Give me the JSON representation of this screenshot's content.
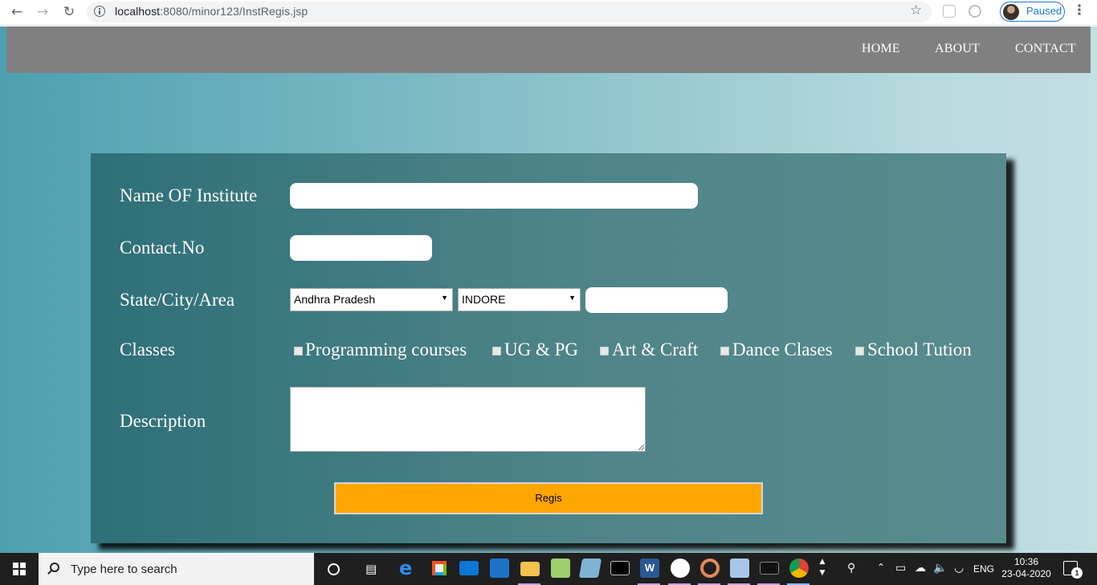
{
  "browser": {
    "url_host": "localhost",
    "url_rest": ":8080/minor123/InstRegis.jsp",
    "profile_status": "Paused"
  },
  "nav": {
    "home": "HOME",
    "about": "ABOUT",
    "contact": "CONTACT"
  },
  "form": {
    "labels": {
      "name": "Name OF Institute",
      "contact": "Contact.No",
      "location": "State/City/Area",
      "classes": "Classes",
      "description": "Description"
    },
    "inputs": {
      "name_value": "",
      "contact_value": "",
      "area_value": "",
      "description_value": ""
    },
    "state_selected": "Andhra Pradesh",
    "city_selected": "INDORE",
    "classes": [
      {
        "label": "Programming courses",
        "checked": false
      },
      {
        "label": "UG & PG",
        "checked": false
      },
      {
        "label": "Art & Craft",
        "checked": false
      },
      {
        "label": "Dance Clases",
        "checked": false
      },
      {
        "label": "School Tution",
        "checked": false
      }
    ],
    "submit_label": "Regis"
  },
  "taskbar": {
    "search_placeholder": "Type here to search",
    "language": "ENG",
    "time": "10:36",
    "date": "23-04-2020",
    "notification_count": "1",
    "apps": [
      "edge-icon",
      "store-icon",
      "mail-icon",
      "audio-app-icon",
      "file-explorer-icon",
      "notepad-icon",
      "onenote-icon",
      "terminal-icon",
      "word-icon",
      "photos-icon",
      "media-player-icon",
      "3d-viewer-icon",
      "console-icon",
      "chrome-icon"
    ]
  }
}
